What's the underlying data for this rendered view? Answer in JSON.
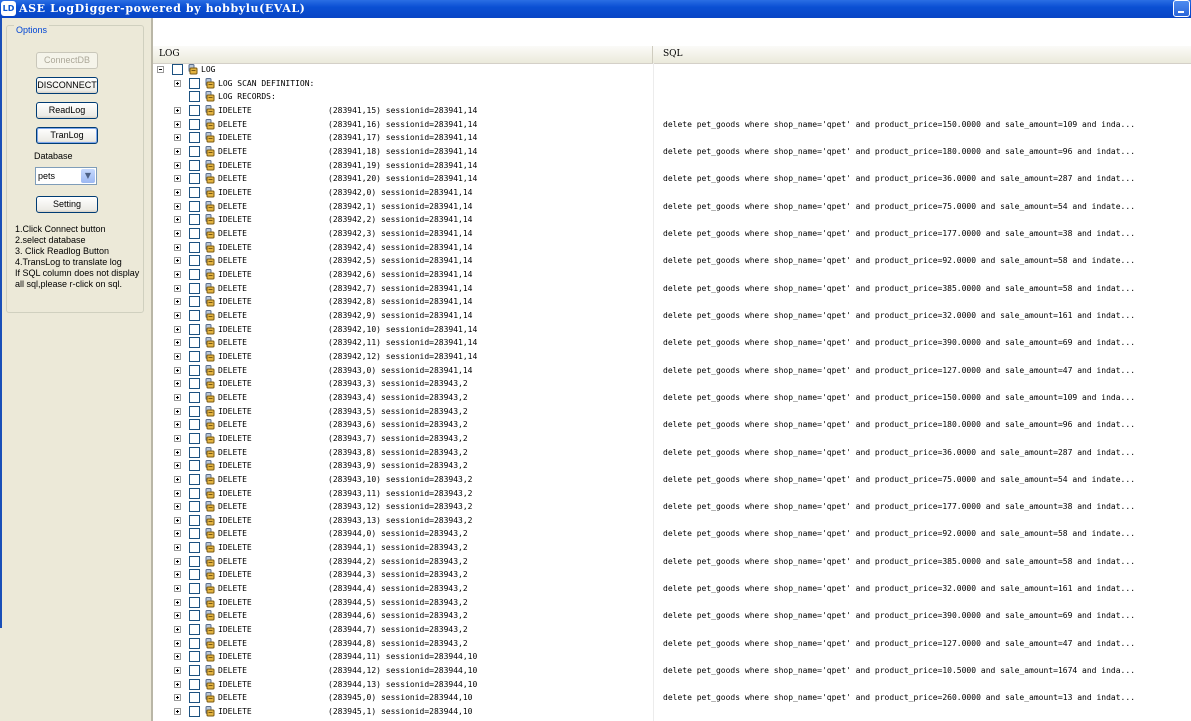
{
  "window": {
    "title": "ASE LogDigger-powered by hobbylu(EVAL)",
    "icon_text": "LD"
  },
  "options": {
    "legend": "Options",
    "connect_label": "ConnectDB",
    "disconnect_label": "DISCONNECT",
    "readlog_label": "ReadLog",
    "tranlog_label": "TranLog",
    "database_label": "Database",
    "database_value": "pets",
    "setting_label": "Setting",
    "instructions": [
      "1.Click Connect button",
      "2.select database",
      "3. Click Readlog Button",
      "4.TransLog to translate log",
      "If SQL column does not display",
      "all sql,please r-click on sql."
    ]
  },
  "grid": {
    "header": {
      "log": "LOG",
      "sql": "SQL"
    },
    "root": {
      "label": "LOG",
      "expanded": true
    },
    "sections": [
      {
        "label": "LOG SCAN DEFINITION:",
        "expandable": true
      },
      {
        "label": "LOG RECORDS:",
        "expandable": false
      }
    ],
    "rows": [
      {
        "op": "IDELETE",
        "pos": "(283941,15) sessionid=283941,14",
        "sql": ""
      },
      {
        "op": "DELETE",
        "pos": "(283941,16) sessionid=283941,14",
        "sql": "delete pet_goods where shop_name='qpet' and product_price=150.0000 and sale_amount=109 and inda..."
      },
      {
        "op": "IDELETE",
        "pos": "(283941,17) sessionid=283941,14",
        "sql": ""
      },
      {
        "op": "DELETE",
        "pos": "(283941,18) sessionid=283941,14",
        "sql": "delete pet_goods where shop_name='qpet' and product_price=180.0000 and sale_amount=96 and indat..."
      },
      {
        "op": "IDELETE",
        "pos": "(283941,19) sessionid=283941,14",
        "sql": ""
      },
      {
        "op": "DELETE",
        "pos": "(283941,20) sessionid=283941,14",
        "sql": "delete pet_goods where shop_name='qpet' and product_price=36.0000 and sale_amount=287 and indat..."
      },
      {
        "op": "IDELETE",
        "pos": "(283942,0) sessionid=283941,14",
        "sql": ""
      },
      {
        "op": "DELETE",
        "pos": "(283942,1) sessionid=283941,14",
        "sql": "delete pet_goods where shop_name='qpet' and product_price=75.0000 and sale_amount=54 and indate..."
      },
      {
        "op": "IDELETE",
        "pos": "(283942,2) sessionid=283941,14",
        "sql": ""
      },
      {
        "op": "DELETE",
        "pos": "(283942,3) sessionid=283941,14",
        "sql": "delete pet_goods where shop_name='qpet' and product_price=177.0000 and sale_amount=38 and indat..."
      },
      {
        "op": "IDELETE",
        "pos": "(283942,4) sessionid=283941,14",
        "sql": ""
      },
      {
        "op": "DELETE",
        "pos": "(283942,5) sessionid=283941,14",
        "sql": "delete pet_goods where shop_name='qpet' and product_price=92.0000 and sale_amount=58 and indate..."
      },
      {
        "op": "IDELETE",
        "pos": "(283942,6) sessionid=283941,14",
        "sql": ""
      },
      {
        "op": "DELETE",
        "pos": "(283942,7) sessionid=283941,14",
        "sql": "delete pet_goods where shop_name='qpet' and product_price=385.0000 and sale_amount=58 and indat..."
      },
      {
        "op": "IDELETE",
        "pos": "(283942,8) sessionid=283941,14",
        "sql": ""
      },
      {
        "op": "DELETE",
        "pos": "(283942,9) sessionid=283941,14",
        "sql": "delete pet_goods where shop_name='qpet' and product_price=32.0000 and sale_amount=161 and indat..."
      },
      {
        "op": "IDELETE",
        "pos": "(283942,10) sessionid=283941,14",
        "sql": ""
      },
      {
        "op": "DELETE",
        "pos": "(283942,11) sessionid=283941,14",
        "sql": "delete pet_goods where shop_name='qpet' and product_price=390.0000 and sale_amount=69 and indat..."
      },
      {
        "op": "IDELETE",
        "pos": "(283942,12) sessionid=283941,14",
        "sql": ""
      },
      {
        "op": "DELETE",
        "pos": "(283943,0) sessionid=283941,14",
        "sql": "delete pet_goods where shop_name='qpet' and product_price=127.0000 and sale_amount=47 and indat..."
      },
      {
        "op": "IDELETE",
        "pos": "(283943,3) sessionid=283943,2",
        "sql": ""
      },
      {
        "op": "DELETE",
        "pos": "(283943,4) sessionid=283943,2",
        "sql": "delete pet_goods where shop_name='qpet' and product_price=150.0000 and sale_amount=109 and inda..."
      },
      {
        "op": "IDELETE",
        "pos": "(283943,5) sessionid=283943,2",
        "sql": ""
      },
      {
        "op": "DELETE",
        "pos": "(283943,6) sessionid=283943,2",
        "sql": "delete pet_goods where shop_name='qpet' and product_price=180.0000 and sale_amount=96 and indat..."
      },
      {
        "op": "IDELETE",
        "pos": "(283943,7) sessionid=283943,2",
        "sql": ""
      },
      {
        "op": "DELETE",
        "pos": "(283943,8) sessionid=283943,2",
        "sql": "delete pet_goods where shop_name='qpet' and product_price=36.0000 and sale_amount=287 and indat..."
      },
      {
        "op": "IDELETE",
        "pos": "(283943,9) sessionid=283943,2",
        "sql": ""
      },
      {
        "op": "DELETE",
        "pos": "(283943,10) sessionid=283943,2",
        "sql": "delete pet_goods where shop_name='qpet' and product_price=75.0000 and sale_amount=54 and indate..."
      },
      {
        "op": "IDELETE",
        "pos": "(283943,11) sessionid=283943,2",
        "sql": ""
      },
      {
        "op": "DELETE",
        "pos": "(283943,12) sessionid=283943,2",
        "sql": "delete pet_goods where shop_name='qpet' and product_price=177.0000 and sale_amount=38 and indat..."
      },
      {
        "op": "IDELETE",
        "pos": "(283943,13) sessionid=283943,2",
        "sql": ""
      },
      {
        "op": "DELETE",
        "pos": "(283944,0) sessionid=283943,2",
        "sql": "delete pet_goods where shop_name='qpet' and product_price=92.0000 and sale_amount=58 and indate..."
      },
      {
        "op": "IDELETE",
        "pos": "(283944,1) sessionid=283943,2",
        "sql": ""
      },
      {
        "op": "DELETE",
        "pos": "(283944,2) sessionid=283943,2",
        "sql": "delete pet_goods where shop_name='qpet' and product_price=385.0000 and sale_amount=58 and indat..."
      },
      {
        "op": "IDELETE",
        "pos": "(283944,3) sessionid=283943,2",
        "sql": ""
      },
      {
        "op": "DELETE",
        "pos": "(283944,4) sessionid=283943,2",
        "sql": "delete pet_goods where shop_name='qpet' and product_price=32.0000 and sale_amount=161 and indat..."
      },
      {
        "op": "IDELETE",
        "pos": "(283944,5) sessionid=283943,2",
        "sql": ""
      },
      {
        "op": "DELETE",
        "pos": "(283944,6) sessionid=283943,2",
        "sql": "delete pet_goods where shop_name='qpet' and product_price=390.0000 and sale_amount=69 and indat..."
      },
      {
        "op": "IDELETE",
        "pos": "(283944,7) sessionid=283943,2",
        "sql": ""
      },
      {
        "op": "DELETE",
        "pos": "(283944,8) sessionid=283943,2",
        "sql": "delete pet_goods where shop_name='qpet' and product_price=127.0000 and sale_amount=47 and indat..."
      },
      {
        "op": "IDELETE",
        "pos": "(283944,11) sessionid=283944,10",
        "sql": ""
      },
      {
        "op": "DELETE",
        "pos": "(283944,12) sessionid=283944,10",
        "sql": "delete pet_goods where shop_name='qpet' and product_price=10.5000 and sale_amount=1674 and inda..."
      },
      {
        "op": "IDELETE",
        "pos": "(283944,13) sessionid=283944,10",
        "sql": ""
      },
      {
        "op": "DELETE",
        "pos": "(283945,0) sessionid=283944,10",
        "sql": "delete pet_goods where shop_name='qpet' and product_price=260.0000 and sale_amount=13 and indat..."
      },
      {
        "op": "IDELETE",
        "pos": "(283945,1) sessionid=283944,10",
        "sql": ""
      }
    ]
  },
  "colors": {
    "titlebar": "#0a4fd3",
    "panel": "#ece9d8",
    "button_border": "#003c74"
  }
}
